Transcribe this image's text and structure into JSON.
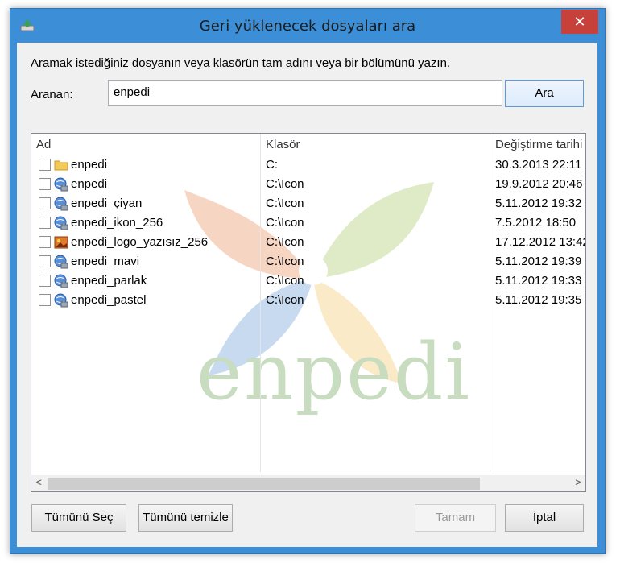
{
  "dialog": {
    "title": "Geri yüklenecek dosyaları ara",
    "close_label": "✕",
    "instruction": "Aramak istediğiniz dosyanın veya klasörün tam adını veya bir bölümünü yazın.",
    "search_label": "Aranan:",
    "search_value": "enpedi",
    "search_button": "Ara"
  },
  "columns": [
    "Ad",
    "Klasör",
    "Değiştirme tarihi"
  ],
  "rows": [
    {
      "name": "enpedi",
      "folder": "C:",
      "date": "30.3.2013 22:11",
      "icon": "folder-icon"
    },
    {
      "name": "enpedi",
      "folder": "C:\\Icon",
      "date": "19.9.2012 20:46",
      "icon": "globe-icon"
    },
    {
      "name": "enpedi_çiyan",
      "folder": "C:\\Icon",
      "date": "5.11.2012 19:32",
      "icon": "globe-icon"
    },
    {
      "name": "enpedi_ikon_256",
      "folder": "C:\\Icon",
      "date": "7.5.2012 18:50",
      "icon": "globe-icon"
    },
    {
      "name": "enpedi_logo_yazısız_256",
      "folder": "C:\\Icon",
      "date": "17.12.2012 13:42",
      "icon": "image-icon"
    },
    {
      "name": "enpedi_mavi",
      "folder": "C:\\Icon",
      "date": "5.11.2012 19:39",
      "icon": "globe-icon"
    },
    {
      "name": "enpedi_parlak",
      "folder": "C:\\Icon",
      "date": "5.11.2012 19:33",
      "icon": "globe-icon"
    },
    {
      "name": "enpedi_pastel",
      "folder": "C:\\Icon",
      "date": "5.11.2012 19:35",
      "icon": "globe-icon"
    }
  ],
  "watermark_text": "enpedi",
  "buttons": {
    "select_all": "Tümünü Seç",
    "clear_all": "Tümünü temizle",
    "ok": "Tamam",
    "cancel": "İptal"
  },
  "scroll": {
    "left": "<",
    "right": ">"
  },
  "colors": {
    "title_bar": "#3c8ed6",
    "close_button": "#c7403a"
  }
}
